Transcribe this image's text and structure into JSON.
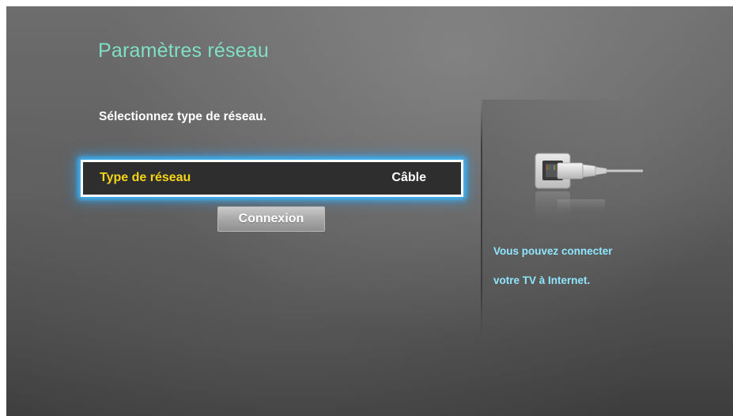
{
  "screen": {
    "title": "Paramètres réseau",
    "instruction": "Sélectionnez type de réseau.",
    "network_type": {
      "label": "Type de réseau",
      "value": "Câble"
    },
    "connect_button": "Connexion"
  },
  "side_panel": {
    "illustration": "ethernet-cable-icon",
    "info_line1": "Vous pouvez connecter",
    "info_line2": "votre TV à Internet."
  },
  "colors": {
    "title": "#7fe0c4",
    "selected_label": "#f5d417",
    "focus_glow": "#3cbeff",
    "info_text": "#8fe6ff"
  }
}
